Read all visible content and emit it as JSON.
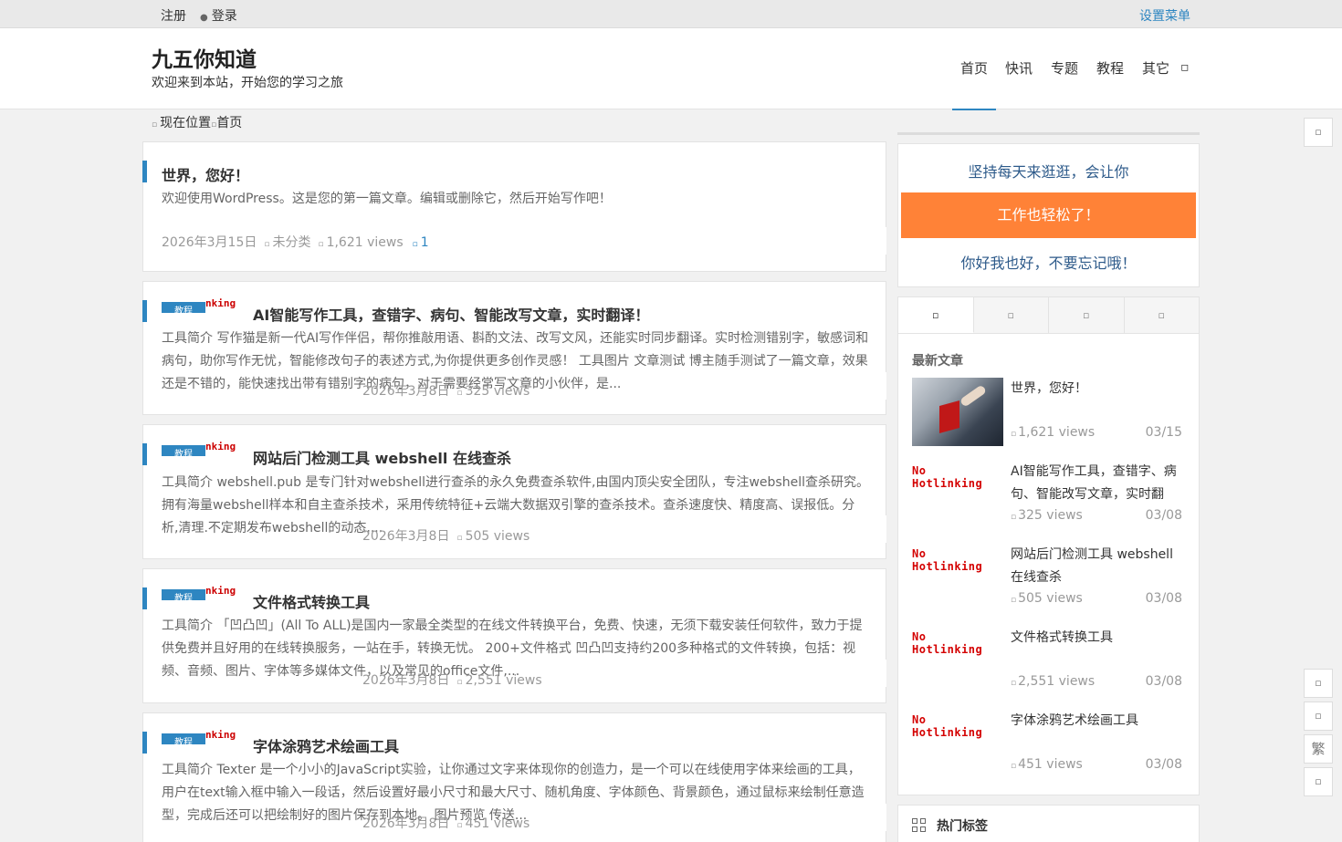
{
  "topbar": {
    "register": "注册",
    "login_icon": "user-icon",
    "login": "登录",
    "settings_menu": "设置菜单"
  },
  "header": {
    "title": "九五你知道",
    "description": "欢迎来到本站，开始您的学习之旅",
    "nav": [
      "首页",
      "快讯",
      "专题",
      "教程",
      "其它"
    ],
    "search_icon": "search-icon"
  },
  "breadcrumb": {
    "icon": "home-icon",
    "text": "现在位置",
    "current": "首页"
  },
  "posts": [
    {
      "title": "世界，您好！",
      "excerpt": "欢迎使用WordPress。这是您的第一篇文章。编辑或删除它，然后开始写作吧！",
      "date": "2026年3月15日",
      "category": "未分类",
      "views": "1,621 views",
      "comments": "1"
    },
    {
      "label": "教程",
      "hotlink": "nking",
      "title": "AI智能写作工具，查错字、病句、智能改写文章，实时翻译！",
      "excerpt": "工具简介 写作猫是新一代AI写作伴侣，帮你推敲用语、斟酌文法、改写文风，还能实时同步翻译。实时检测错别字，敏感词和病句，助你写作无忧，智能修改句子的表述方式,为你提供更多创作灵感！ 工具图片 文章测试 博主随手测试了一篇文章，效果还是不错的，能快速找出带有错别字的病句，对于需要经常写文章的小伙伴，是...",
      "date": "2026年3月8日",
      "views": "325 views"
    },
    {
      "label": "教程",
      "hotlink": "nking",
      "title": "网站后门检测工具 webshell 在线查杀",
      "excerpt": "工具简介 webshell.pub 是专门针对webshell进行查杀的永久免费查杀软件,由国内顶尖安全团队，专注webshell查杀研究。拥有海量webshell样本和自主查杀技术，采用传统特征+云端大数据双引擎的查杀技术。查杀速度快、精度高、误报低。分析,清理.不定期发布webshell的动态,...",
      "date": "2026年3月8日",
      "views": "505 views"
    },
    {
      "label": "教程",
      "hotlink": "nking",
      "title": "文件格式转换工具",
      "excerpt": "工具简介 「凹凸凹」(All To ALL)是国内一家最全类型的在线文件转换平台，免费、快速，无须下载安装任何软件，致力于提供免费并且好用的在线转换服务，一站在手，转换无忧。 200+文件格式 凹凸凹支持约200多种格式的文件转换，包括：视频、音频、图片、字体等多媒体文件，以及常见的office文件,...",
      "date": "2026年3月8日",
      "views": "2,551 views"
    },
    {
      "label": "教程",
      "hotlink": "nking",
      "title": "字体涂鸦艺术绘画工具",
      "excerpt": "工具简介 Texter 是一个小小的JavaScript实验，让你通过文字来体现你的创造力，是一个可以在线使用字体来绘画的工具，用户在text输入框中输入一段话，然后设置好最小尺寸和最大尺寸、随机角度、字体颜色、背景颜色，通过鼠标来绘制任意造型，完成后还可以把绘制好的图片保存到本地。 图片预览 传送...",
      "date": "2026年3月8日",
      "views": "451 views"
    }
  ],
  "sidebar": {
    "promo": {
      "line1": "坚持每天来逛逛，会让你",
      "line2": "工作也轻松了！",
      "line3": "你好我也好，不要忘记哦！"
    },
    "tabs": [
      "list-icon",
      "fire-icon",
      "comment-icon",
      "tag-icon"
    ],
    "latest_heading": "最新文章",
    "no_hotlink_text": "No Hotlinking",
    "latest": [
      {
        "title": "世界，您好！",
        "views": "1,621 views",
        "date": "03/15"
      },
      {
        "title": "AI智能写作工具，查错字、病句、智能改写文章，实时翻",
        "views": "325 views",
        "date": "03/08"
      },
      {
        "title": "网站后门检测工具 webshell 在线查杀",
        "views": "505 views",
        "date": "03/08"
      },
      {
        "title": "文件格式转换工具",
        "views": "2,551 views",
        "date": "03/08"
      },
      {
        "title": "字体涂鸦艺术绘画工具",
        "views": "451 views",
        "date": "03/08"
      }
    ],
    "tags_heading": "热门标签"
  },
  "float_buttons": {
    "traditional": "繁"
  }
}
